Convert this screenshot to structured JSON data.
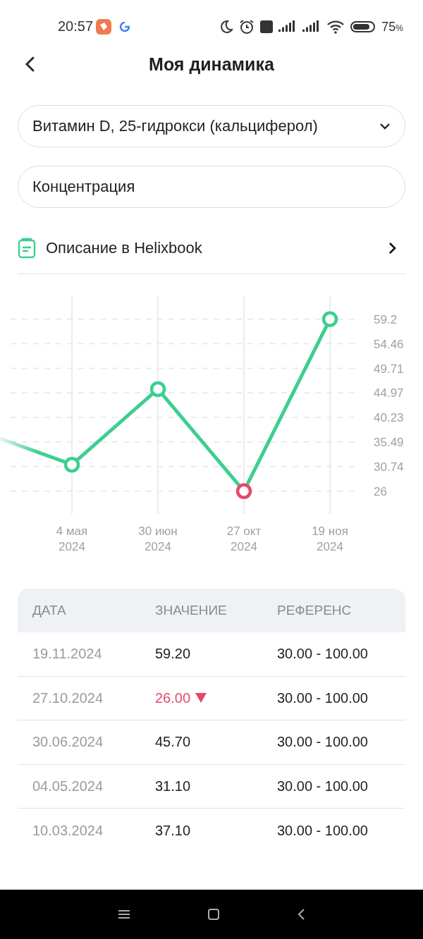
{
  "status_bar": {
    "time": "20:57",
    "battery": "75",
    "battery_unit": "%"
  },
  "header": {
    "title": "Моя динамика"
  },
  "analyte_select": {
    "value": "Витамин D, 25-гидрокси (кальциферол)"
  },
  "measure_field": {
    "value": "Концентрация"
  },
  "helixbook_link": {
    "label": "Описание в Helixbook"
  },
  "chart": {
    "chart_data": {
      "type": "line",
      "categories": [
        null,
        "4 мая\n2024",
        "30 июн\n2024",
        "27 окт\n2024",
        "19 ноя\n2024"
      ],
      "series": [
        {
          "color": "#3ccf8e",
          "marker": "circle",
          "values": [
            null,
            31.1,
            45.7,
            26,
            59.2
          ]
        }
      ],
      "grid": true,
      "ylim": [
        21.6,
        63.8
      ],
      "yticks": [
        {
          "value": 59.2,
          "label": "59.2"
        },
        {
          "value": 54.46,
          "label": "54.46"
        },
        {
          "value": 49.71,
          "label": "49.71"
        },
        {
          "value": 44.97,
          "label": "44.97"
        },
        {
          "value": 40.23,
          "label": "40.23"
        },
        {
          "value": 35.49,
          "label": "35.49"
        },
        {
          "value": 30.74,
          "label": "30.74"
        },
        {
          "value": 26,
          "label": "26"
        }
      ]
    }
  },
  "table": {
    "columns": [
      "ДАТА",
      "ЗНАЧЕНИЕ",
      "РЕФЕРЕНС"
    ],
    "rows": [
      {
        "date": "19.11.2024",
        "value": "59.20",
        "reference": "30.00 - 100.00",
        "low": false
      },
      {
        "date": "27.10.2024",
        "value": "26.00",
        "reference": "30.00 - 100.00",
        "low": true
      },
      {
        "date": "30.06.2024",
        "value": "45.70",
        "reference": "30.00 - 100.00",
        "low": false
      },
      {
        "date": "04.05.2024",
        "value": "31.10",
        "reference": "30.00 - 100.00",
        "low": false
      },
      {
        "date": "10.03.2024",
        "value": "37.10",
        "reference": "30.00 - 100.00",
        "low": false
      }
    ]
  }
}
